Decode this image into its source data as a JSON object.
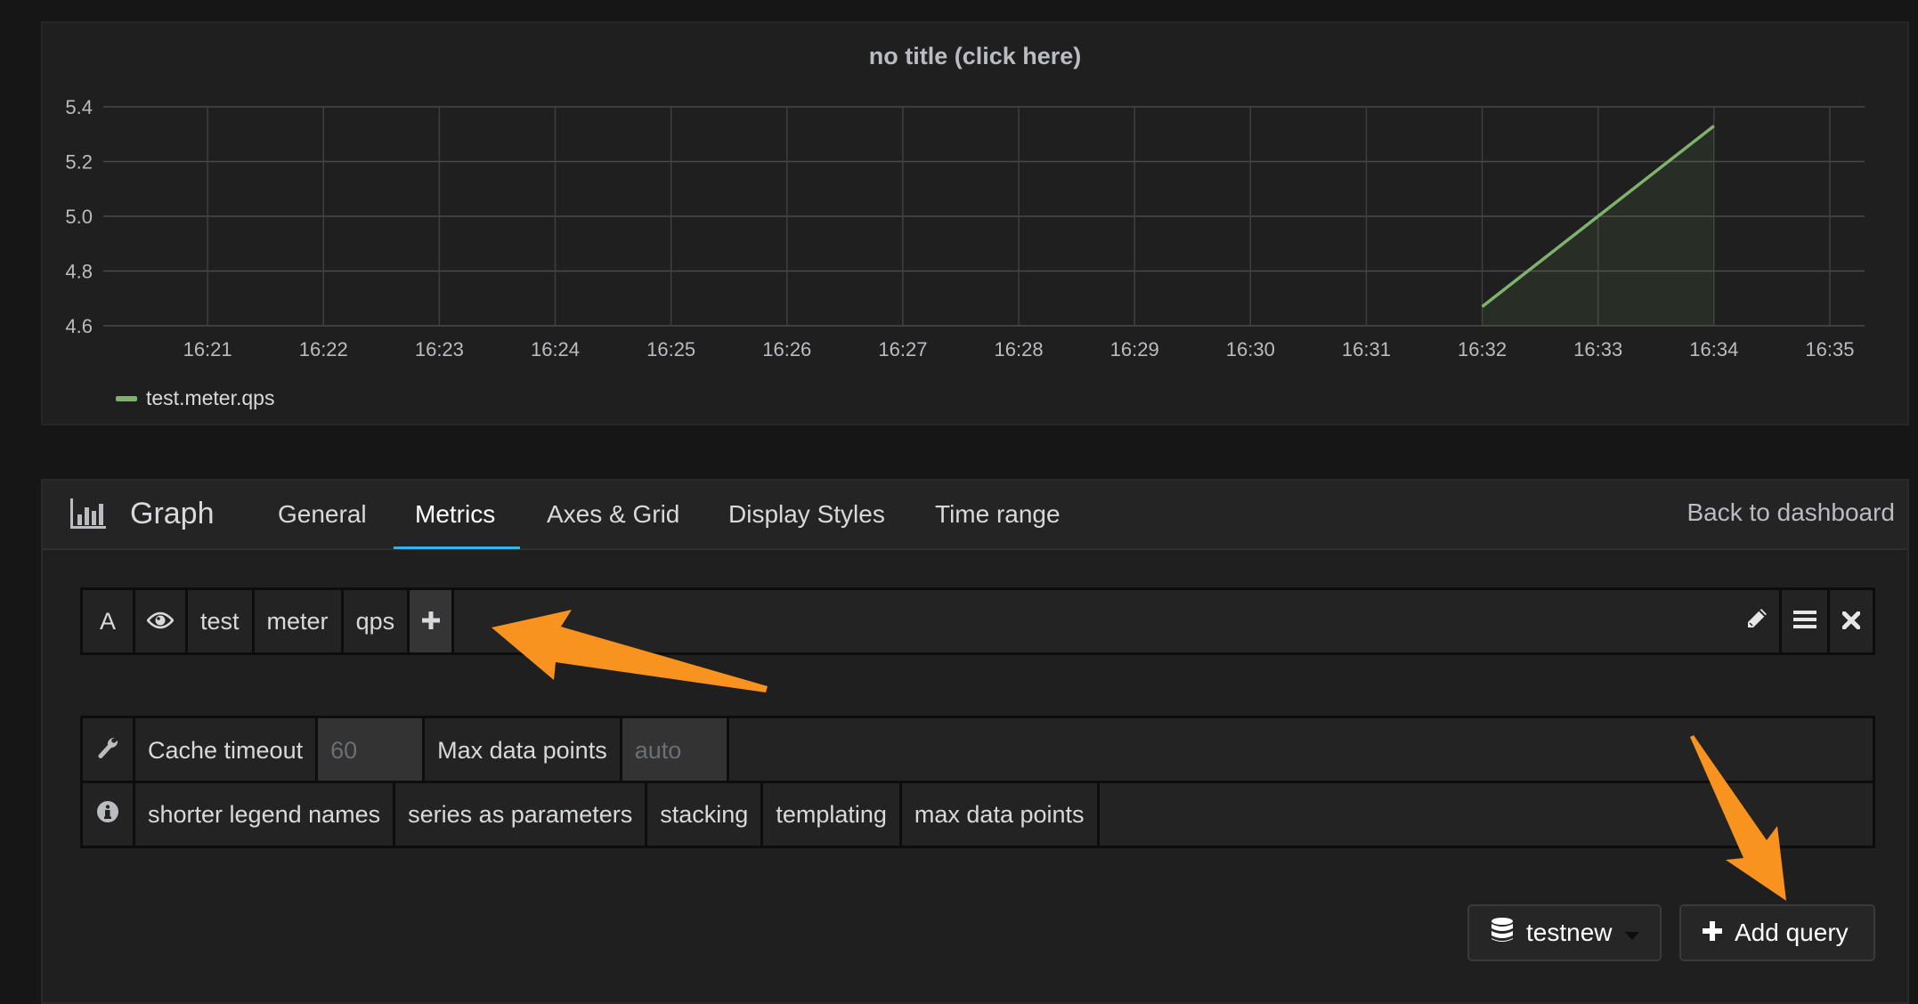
{
  "panel": {
    "title": "no title (click here)",
    "legend": [
      {
        "label": "test.meter.qps",
        "color": "#7eb26d"
      }
    ]
  },
  "chart_data": {
    "type": "line",
    "title": "no title (click here)",
    "xlabel": "",
    "ylabel": "",
    "x_ticks": [
      "16:21",
      "16:22",
      "16:23",
      "16:24",
      "16:25",
      "16:26",
      "16:27",
      "16:28",
      "16:29",
      "16:30",
      "16:31",
      "16:32",
      "16:33",
      "16:34",
      "16:35"
    ],
    "y_ticks": [
      "5.4",
      "5.2",
      "5.0",
      "4.8",
      "4.6"
    ],
    "ylim": [
      4.6,
      5.4
    ],
    "xlim_minutes": [
      20.1,
      35.3
    ],
    "grid": true,
    "legend_position": "bottom-left",
    "series": [
      {
        "name": "test.meter.qps",
        "color": "#7eb26d",
        "fill": true,
        "x": [
          "16:32",
          "16:33",
          "16:34"
        ],
        "x_minutes": [
          32,
          33,
          34
        ],
        "values": [
          4.67,
          5.0,
          5.33
        ]
      }
    ]
  },
  "editor": {
    "panel_type": "Graph",
    "tabs": [
      {
        "label": "General",
        "active": false
      },
      {
        "label": "Metrics",
        "active": true
      },
      {
        "label": "Axes & Grid",
        "active": false
      },
      {
        "label": "Display Styles",
        "active": false
      },
      {
        "label": "Time range",
        "active": false
      }
    ],
    "back_link": "Back to dashboard",
    "query": {
      "ref_id": "A",
      "segments": [
        "test",
        "meter",
        "qps"
      ]
    },
    "options": {
      "cache_timeout_label": "Cache timeout",
      "cache_timeout_placeholder": "60",
      "max_data_points_label": "Max data points",
      "max_data_points_placeholder": "auto"
    },
    "help_links": [
      "shorter legend names",
      "series as parameters",
      "stacking",
      "templating",
      "max data points"
    ],
    "datasource": "testnew",
    "add_query_label": "Add query"
  },
  "annotations": {
    "arrow_color": "#f7931e"
  }
}
